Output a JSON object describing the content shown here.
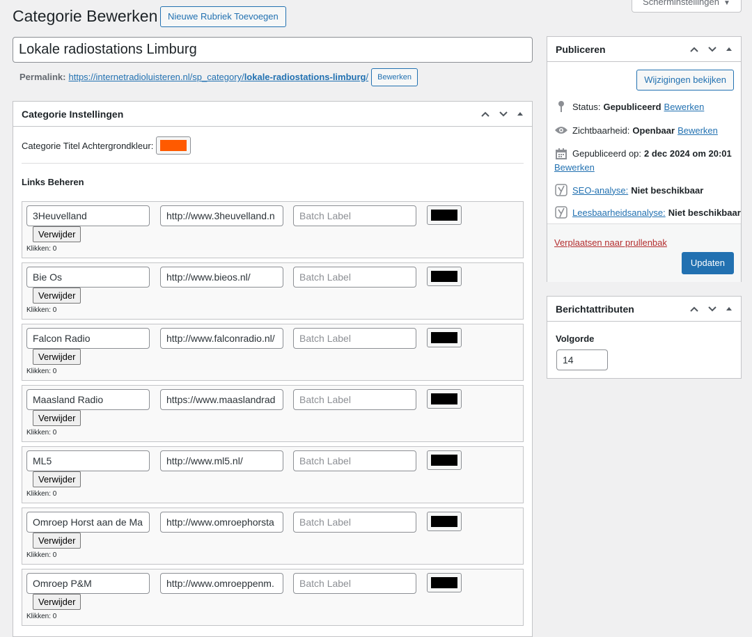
{
  "header": {
    "screen_options_label": "Scherminstellingen",
    "page_title": "Categorie Bewerken",
    "add_new_label": "Nieuwe Rubriek Toevoegen"
  },
  "title_field": {
    "value": "Lokale radiostations Limburg"
  },
  "permalink": {
    "label": "Permalink:",
    "url_base": "https://internetradioluisteren.nl/sp_category/",
    "url_slug": "lokale-radiostations-limburg",
    "url_end": "/",
    "edit_label": "Bewerken"
  },
  "category_settings": {
    "title": "Categorie Instellingen",
    "bg_color_label": "Categorie Titel Achtergrondkleur:",
    "bg_color": "#ff5a00",
    "links_heading": "Links Beheren",
    "delete_label": "Verwijder",
    "batch_placeholder": "Batch Label",
    "links": [
      {
        "name": "3Heuvelland",
        "url": "http://www.3heuvelland.n",
        "clicks": "Klikken: 0"
      },
      {
        "name": "Bie Os",
        "url": "http://www.bieos.nl/",
        "clicks": "Klikken: 0"
      },
      {
        "name": "Falcon Radio",
        "url": "http://www.falconradio.nl/",
        "clicks": "Klikken: 0"
      },
      {
        "name": "Maasland Radio",
        "url": "https://www.maaslandrad",
        "clicks": "Klikken: 0"
      },
      {
        "name": "ML5",
        "url": "http://www.ml5.nl/",
        "clicks": "Klikken: 0"
      },
      {
        "name": "Omroep Horst aan de Ma",
        "url": "http://www.omroephorsta",
        "clicks": "Klikken: 0"
      },
      {
        "name": "Omroep P&M",
        "url": "http://www.omroeppenm.",
        "clicks": "Klikken: 0"
      }
    ]
  },
  "publish": {
    "title": "Publiceren",
    "preview_label": "Wijzigingen bekijken",
    "status_label": "Status:",
    "status_value": "Gepubliceerd",
    "visibility_label": "Zichtbaarheid:",
    "visibility_value": "Openbaar",
    "published_label": "Gepubliceerd op:",
    "published_value": "2 dec 2024 om 20:01",
    "edit_label": "Bewerken",
    "seo_label": "SEO-analyse:",
    "seo_value": "Niet beschikbaar",
    "readability_label": "Leesbaarheidsanalyse:",
    "readability_value": "Niet beschikbaar",
    "trash_label": "Verplaatsen naar prullenbak",
    "update_label": "Updaten"
  },
  "attributes": {
    "title": "Berichtattributen",
    "order_label": "Volgorde",
    "order_value": "14"
  }
}
